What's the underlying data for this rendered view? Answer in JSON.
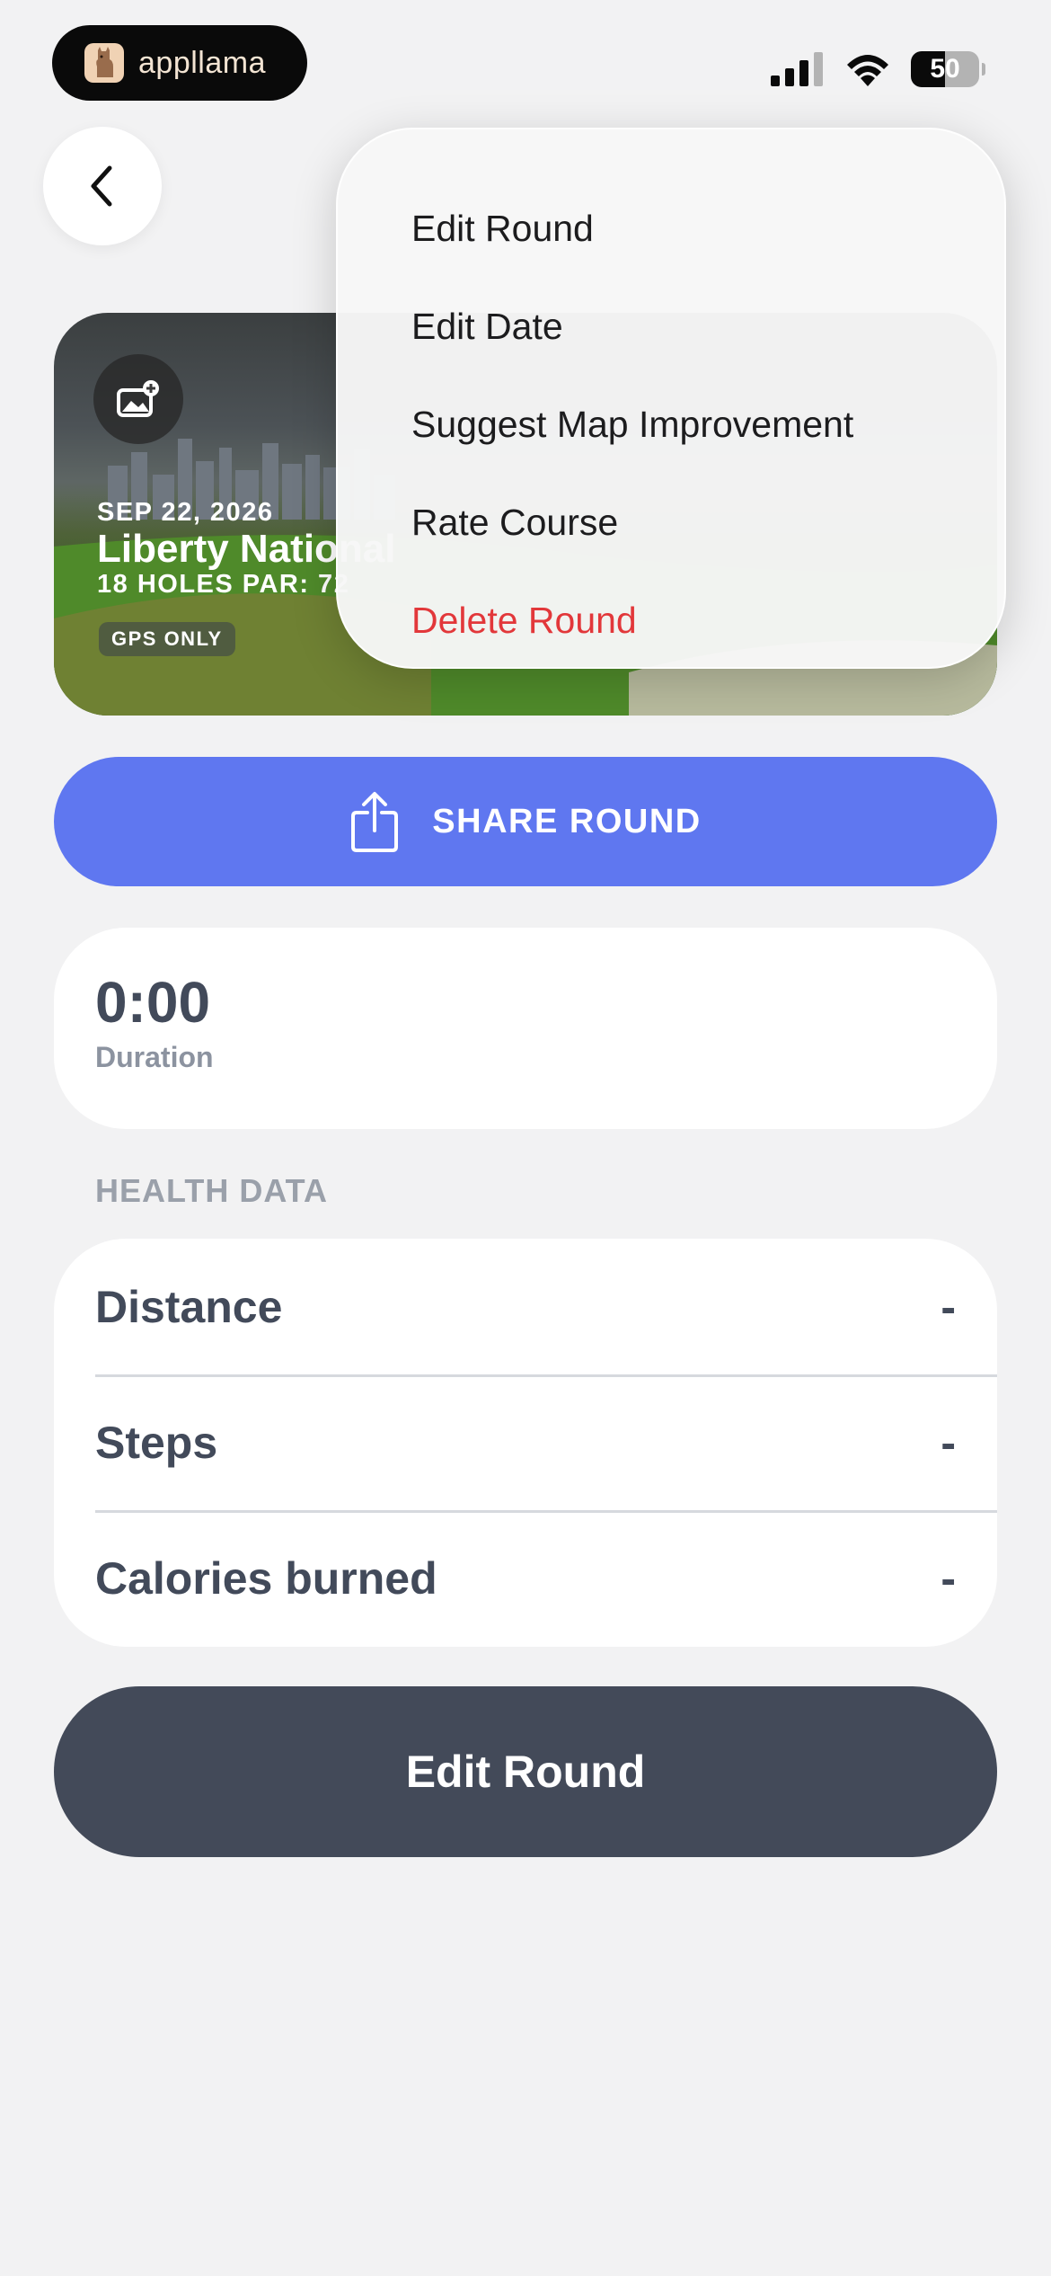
{
  "status_bar": {
    "app_badge": "appllama",
    "battery": "50",
    "icons": [
      "signal-icon",
      "wifi-icon",
      "battery-icon"
    ]
  },
  "nav": {
    "back_icon": "chevron-left-icon"
  },
  "course_card": {
    "date": "SEP 22, 2026",
    "course_name": "Liberty National",
    "details": "18 HOLES  PAR: 72",
    "badge": "GPS ONLY",
    "photo_icon": "add-photo-icon"
  },
  "menu": {
    "items": [
      {
        "label": "Edit Round"
      },
      {
        "label": "Edit Date"
      },
      {
        "label": "Suggest Map Improvement"
      },
      {
        "label": "Rate Course"
      },
      {
        "label": "Delete Round"
      }
    ],
    "danger_color": "#e2373a"
  },
  "share": {
    "label": "SHARE ROUND",
    "icon": "share-icon",
    "color": "#5f77f0"
  },
  "duration": {
    "value": "0:00",
    "label": "Duration"
  },
  "health": {
    "section_title": "HEALTH DATA",
    "rows": [
      {
        "label": "Distance",
        "value": "-"
      },
      {
        "label": "Steps",
        "value": "-"
      },
      {
        "label": "Calories burned",
        "value": "-"
      }
    ]
  },
  "edit_button": {
    "label": "Edit Round",
    "color": "#434a59"
  }
}
